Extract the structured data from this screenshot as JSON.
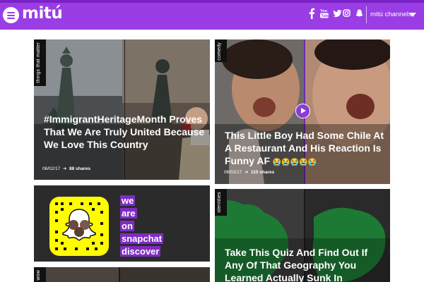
{
  "header": {
    "logo": "mitú",
    "channels_label": "mitú channels",
    "social": [
      {
        "icon": "facebook-icon",
        "glyph": "f"
      },
      {
        "icon": "youtube-icon",
        "glyph": ""
      },
      {
        "icon": "twitter-icon",
        "glyph": ""
      },
      {
        "icon": "instagram-icon",
        "glyph": ""
      },
      {
        "icon": "snapchat-icon",
        "glyph": ""
      }
    ]
  },
  "colors": {
    "brand_purple": "#9a3de4",
    "snapchat_yellow": "#fffc00",
    "map_green": "#1d7a34"
  },
  "cards": [
    {
      "category": "things that matter",
      "headline": "#ImmigrantHeritageMonth Proves That We Are Truly United Because We Love This Country",
      "date": "06/02/17",
      "shares": "88 shares"
    },
    {
      "category": "comedy",
      "headline": "This Little Boy Had Some Chile At A Restaurant And His Reaction Is Funny AF",
      "emoji": "😭😭😭😭😭",
      "date": "06/02/17",
      "shares": "110 shares"
    },
    {
      "words": [
        "we",
        "are",
        "on",
        "snapchat",
        "discover"
      ]
    },
    {
      "category": "identities",
      "headline": "Take This Quiz And Find Out If Any Of That Geography You Learned Actually Sunk In"
    },
    {
      "category": "wow"
    }
  ]
}
